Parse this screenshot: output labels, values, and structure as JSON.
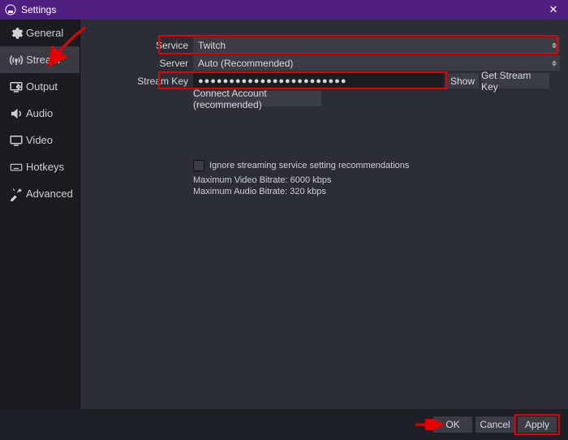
{
  "window": {
    "title": "Settings"
  },
  "sidebar": {
    "items": [
      {
        "label": "General"
      },
      {
        "label": "Stream"
      },
      {
        "label": "Output"
      },
      {
        "label": "Audio"
      },
      {
        "label": "Video"
      },
      {
        "label": "Hotkeys"
      },
      {
        "label": "Advanced"
      }
    ]
  },
  "stream": {
    "service_label": "Service",
    "service_value": "Twitch",
    "server_label": "Server",
    "server_value": "Auto (Recommended)",
    "streamkey_label": "Stream Key",
    "streamkey_value": "●●●●●●●●●●●●●●●●●●●●●●●●",
    "show_label": "Show",
    "get_key_label": "Get Stream Key",
    "connect_account_label": "Connect Account (recommended)",
    "ignore_recs_label": "Ignore streaming service setting recommendations",
    "max_video_bitrate": "Maximum Video Bitrate: 6000 kbps",
    "max_audio_bitrate": "Maximum Audio Bitrate: 320 kbps"
  },
  "footer": {
    "ok": "OK",
    "cancel": "Cancel",
    "apply": "Apply"
  }
}
